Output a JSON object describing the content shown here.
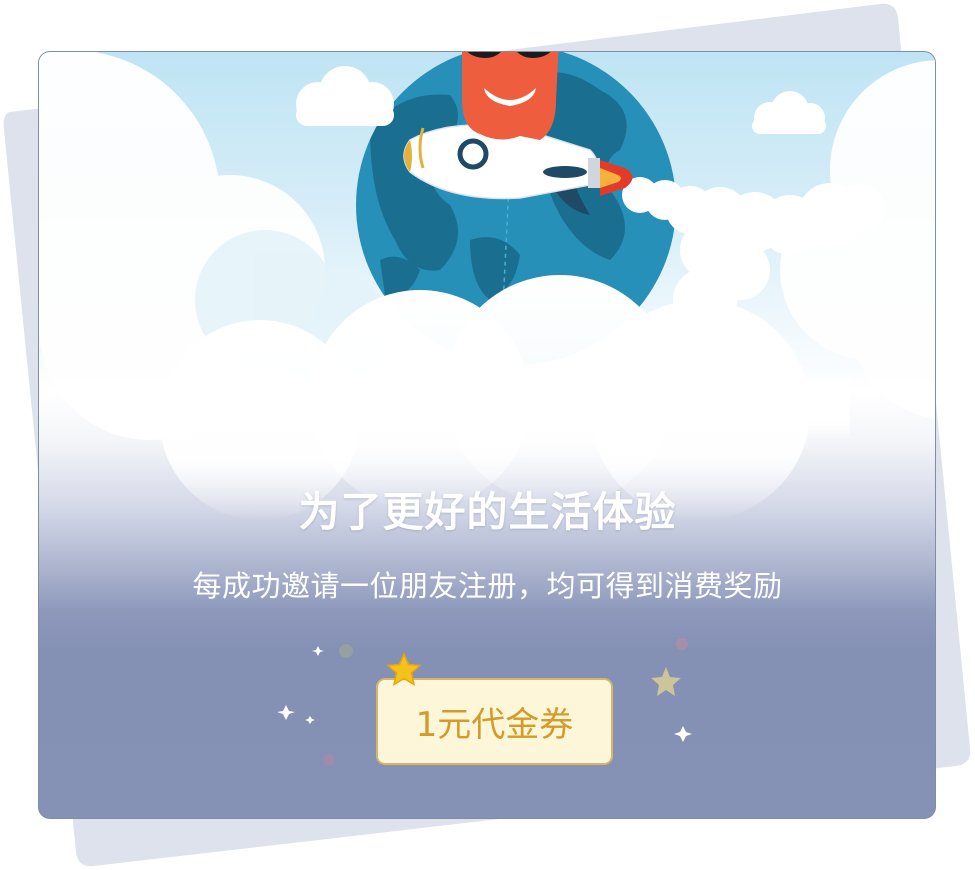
{
  "colors": {
    "sky": "#bfe4f4",
    "footer_blue": "#8591b5",
    "coupon_bg": "#fef6d8",
    "coupon_border": "#d9b46e",
    "coupon_text": "#d49a2a",
    "mascot": "#ef5d3f",
    "rocket_flame": "#e33b2b"
  },
  "hero": {
    "illustration": "rocket-globe-mascot-illustration"
  },
  "headline": "为了更好的生活体验",
  "subline": "每成功邀请一位朋友注册，均可得到消费奖励",
  "coupon": {
    "label": "1元代金券",
    "icon": "star-icon"
  }
}
